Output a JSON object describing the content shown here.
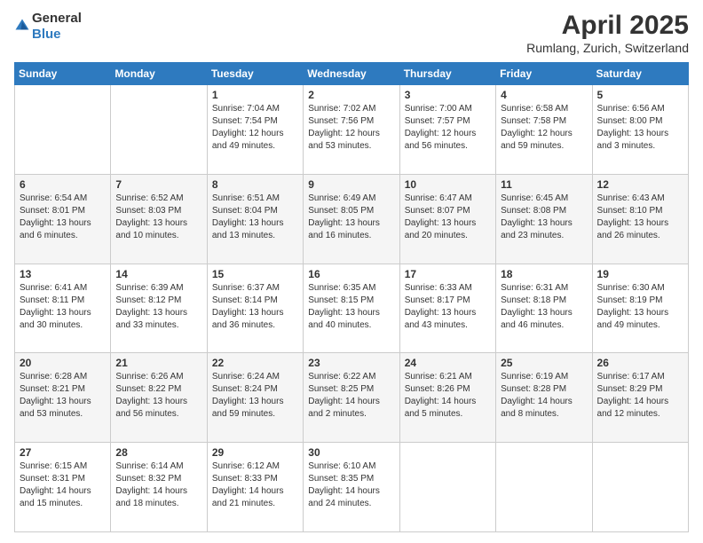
{
  "logo": {
    "general": "General",
    "blue": "Blue"
  },
  "header": {
    "title": "April 2025",
    "subtitle": "Rumlang, Zurich, Switzerland"
  },
  "days_of_week": [
    "Sunday",
    "Monday",
    "Tuesday",
    "Wednesday",
    "Thursday",
    "Friday",
    "Saturday"
  ],
  "weeks": [
    [
      {
        "day": "",
        "info": ""
      },
      {
        "day": "",
        "info": ""
      },
      {
        "day": "1",
        "info": "Sunrise: 7:04 AM\nSunset: 7:54 PM\nDaylight: 12 hours and 49 minutes."
      },
      {
        "day": "2",
        "info": "Sunrise: 7:02 AM\nSunset: 7:56 PM\nDaylight: 12 hours and 53 minutes."
      },
      {
        "day": "3",
        "info": "Sunrise: 7:00 AM\nSunset: 7:57 PM\nDaylight: 12 hours and 56 minutes."
      },
      {
        "day": "4",
        "info": "Sunrise: 6:58 AM\nSunset: 7:58 PM\nDaylight: 12 hours and 59 minutes."
      },
      {
        "day": "5",
        "info": "Sunrise: 6:56 AM\nSunset: 8:00 PM\nDaylight: 13 hours and 3 minutes."
      }
    ],
    [
      {
        "day": "6",
        "info": "Sunrise: 6:54 AM\nSunset: 8:01 PM\nDaylight: 13 hours and 6 minutes."
      },
      {
        "day": "7",
        "info": "Sunrise: 6:52 AM\nSunset: 8:03 PM\nDaylight: 13 hours and 10 minutes."
      },
      {
        "day": "8",
        "info": "Sunrise: 6:51 AM\nSunset: 8:04 PM\nDaylight: 13 hours and 13 minutes."
      },
      {
        "day": "9",
        "info": "Sunrise: 6:49 AM\nSunset: 8:05 PM\nDaylight: 13 hours and 16 minutes."
      },
      {
        "day": "10",
        "info": "Sunrise: 6:47 AM\nSunset: 8:07 PM\nDaylight: 13 hours and 20 minutes."
      },
      {
        "day": "11",
        "info": "Sunrise: 6:45 AM\nSunset: 8:08 PM\nDaylight: 13 hours and 23 minutes."
      },
      {
        "day": "12",
        "info": "Sunrise: 6:43 AM\nSunset: 8:10 PM\nDaylight: 13 hours and 26 minutes."
      }
    ],
    [
      {
        "day": "13",
        "info": "Sunrise: 6:41 AM\nSunset: 8:11 PM\nDaylight: 13 hours and 30 minutes."
      },
      {
        "day": "14",
        "info": "Sunrise: 6:39 AM\nSunset: 8:12 PM\nDaylight: 13 hours and 33 minutes."
      },
      {
        "day": "15",
        "info": "Sunrise: 6:37 AM\nSunset: 8:14 PM\nDaylight: 13 hours and 36 minutes."
      },
      {
        "day": "16",
        "info": "Sunrise: 6:35 AM\nSunset: 8:15 PM\nDaylight: 13 hours and 40 minutes."
      },
      {
        "day": "17",
        "info": "Sunrise: 6:33 AM\nSunset: 8:17 PM\nDaylight: 13 hours and 43 minutes."
      },
      {
        "day": "18",
        "info": "Sunrise: 6:31 AM\nSunset: 8:18 PM\nDaylight: 13 hours and 46 minutes."
      },
      {
        "day": "19",
        "info": "Sunrise: 6:30 AM\nSunset: 8:19 PM\nDaylight: 13 hours and 49 minutes."
      }
    ],
    [
      {
        "day": "20",
        "info": "Sunrise: 6:28 AM\nSunset: 8:21 PM\nDaylight: 13 hours and 53 minutes."
      },
      {
        "day": "21",
        "info": "Sunrise: 6:26 AM\nSunset: 8:22 PM\nDaylight: 13 hours and 56 minutes."
      },
      {
        "day": "22",
        "info": "Sunrise: 6:24 AM\nSunset: 8:24 PM\nDaylight: 13 hours and 59 minutes."
      },
      {
        "day": "23",
        "info": "Sunrise: 6:22 AM\nSunset: 8:25 PM\nDaylight: 14 hours and 2 minutes."
      },
      {
        "day": "24",
        "info": "Sunrise: 6:21 AM\nSunset: 8:26 PM\nDaylight: 14 hours and 5 minutes."
      },
      {
        "day": "25",
        "info": "Sunrise: 6:19 AM\nSunset: 8:28 PM\nDaylight: 14 hours and 8 minutes."
      },
      {
        "day": "26",
        "info": "Sunrise: 6:17 AM\nSunset: 8:29 PM\nDaylight: 14 hours and 12 minutes."
      }
    ],
    [
      {
        "day": "27",
        "info": "Sunrise: 6:15 AM\nSunset: 8:31 PM\nDaylight: 14 hours and 15 minutes."
      },
      {
        "day": "28",
        "info": "Sunrise: 6:14 AM\nSunset: 8:32 PM\nDaylight: 14 hours and 18 minutes."
      },
      {
        "day": "29",
        "info": "Sunrise: 6:12 AM\nSunset: 8:33 PM\nDaylight: 14 hours and 21 minutes."
      },
      {
        "day": "30",
        "info": "Sunrise: 6:10 AM\nSunset: 8:35 PM\nDaylight: 14 hours and 24 minutes."
      },
      {
        "day": "",
        "info": ""
      },
      {
        "day": "",
        "info": ""
      },
      {
        "day": "",
        "info": ""
      }
    ]
  ]
}
